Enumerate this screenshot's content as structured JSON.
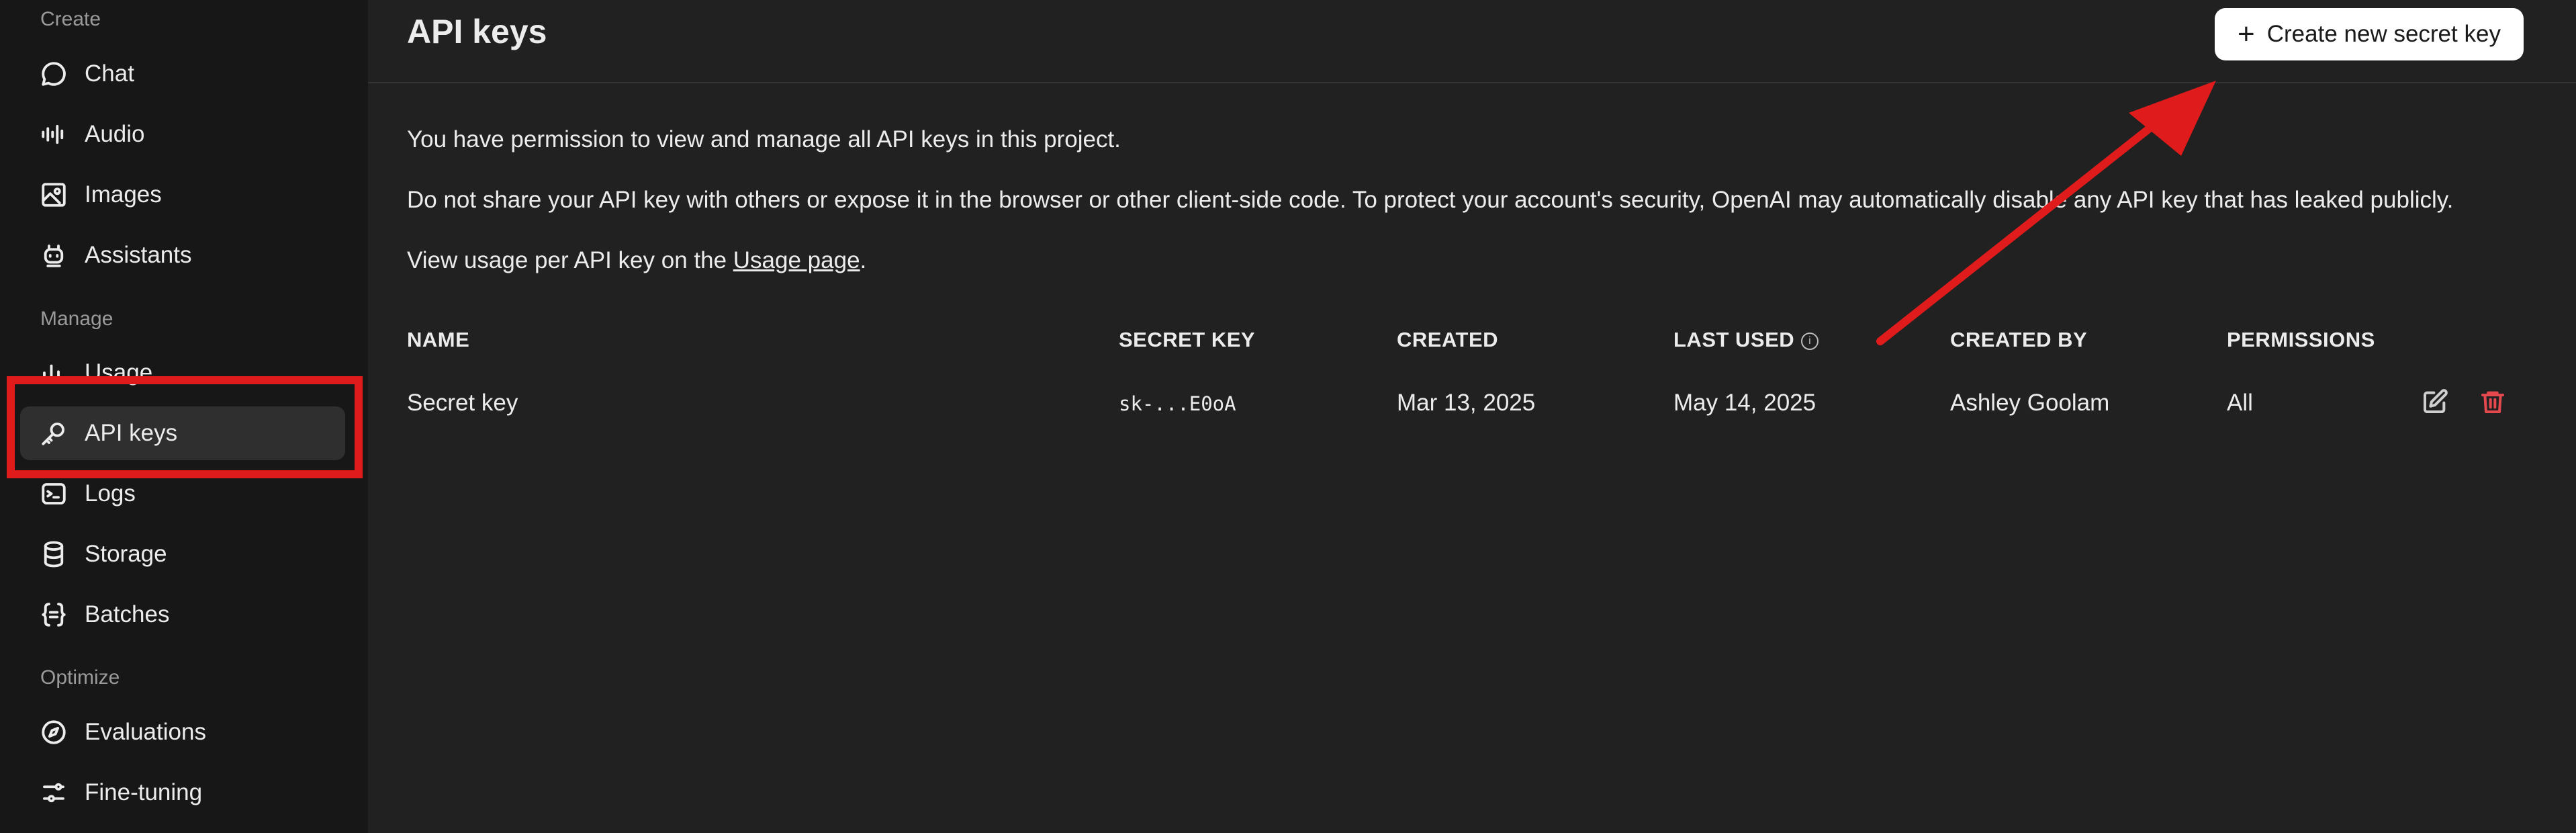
{
  "sidebar": {
    "sections": {
      "create": "Create",
      "manage": "Manage",
      "optimize": "Optimize"
    },
    "items": [
      {
        "label": "Chat",
        "icon": "chat-bubble-icon"
      },
      {
        "label": "Audio",
        "icon": "audio-wave-icon"
      },
      {
        "label": "Images",
        "icon": "image-icon"
      },
      {
        "label": "Assistants",
        "icon": "robot-icon"
      },
      {
        "label": "Usage",
        "icon": "bar-chart-icon"
      },
      {
        "label": "API keys",
        "icon": "key-icon",
        "active": true
      },
      {
        "label": "Logs",
        "icon": "terminal-icon"
      },
      {
        "label": "Storage",
        "icon": "database-icon"
      },
      {
        "label": "Batches",
        "icon": "braces-icon"
      },
      {
        "label": "Evaluations",
        "icon": "compass-icon"
      },
      {
        "label": "Fine-tuning",
        "icon": "sliders-icon"
      }
    ]
  },
  "header": {
    "title": "API keys",
    "create_button": "Create new secret key"
  },
  "description": {
    "line1": "You have permission to view and manage all API keys in this project.",
    "line2": "Do not share your API key with others or expose it in the browser or other client-side code. To protect your account's security, OpenAI may automatically disable any API key that has leaked publicly.",
    "line3_prefix": "View usage per API key on the ",
    "line3_link": "Usage page",
    "line3_suffix": "."
  },
  "table": {
    "columns": [
      "NAME",
      "SECRET KEY",
      "CREATED",
      "LAST USED",
      "CREATED BY",
      "PERMISSIONS"
    ],
    "rows": [
      {
        "name": "Secret key",
        "secret_key": "sk-...E0oA",
        "created": "Mar 13, 2025",
        "last_used": "May 14, 2025",
        "created_by": "Ashley Goolam",
        "permissions": "All"
      }
    ]
  },
  "colors": {
    "annotation_red": "#e01b1b",
    "delete_red": "#e5484d",
    "background": "#212121",
    "sidebar": "#171717"
  }
}
